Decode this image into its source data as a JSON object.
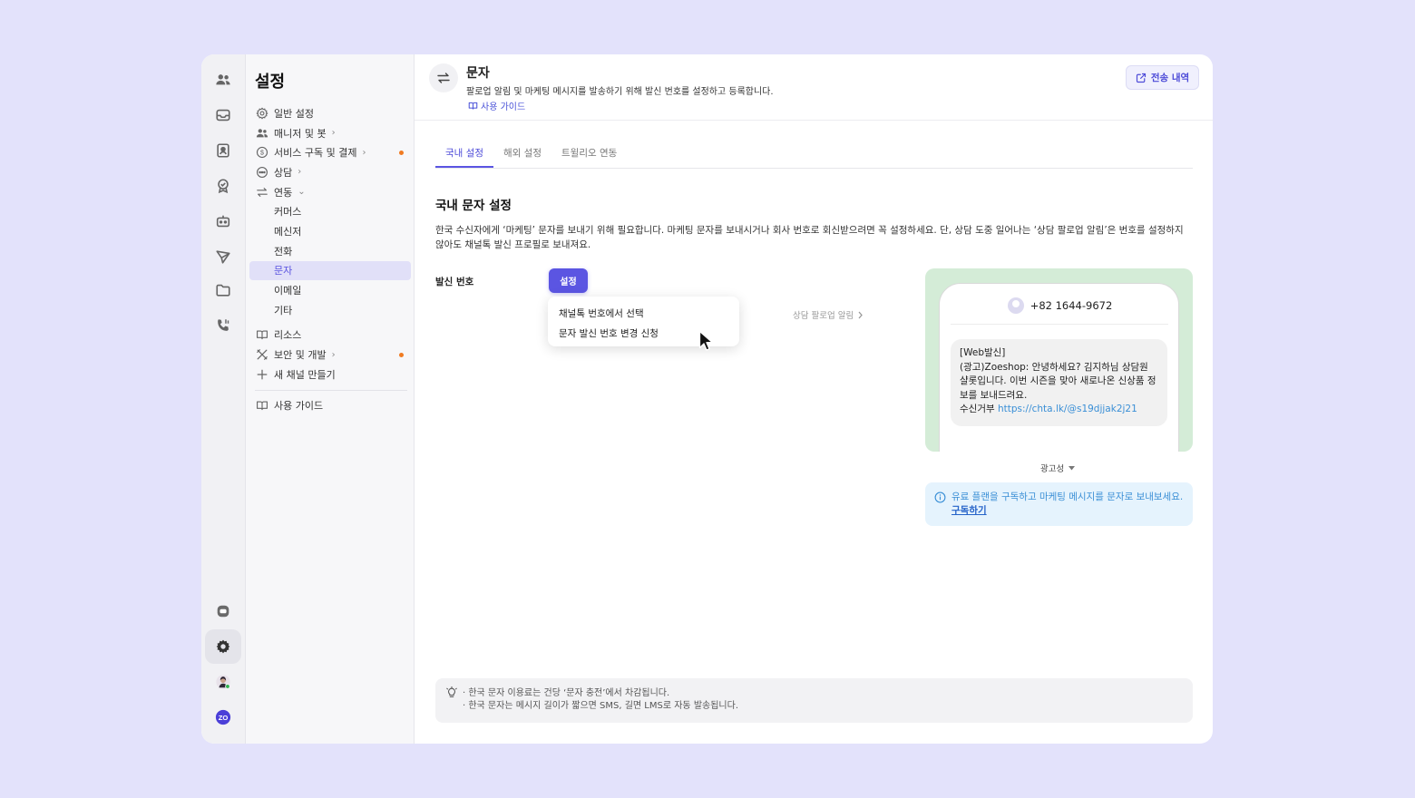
{
  "sidebar": {
    "title": "설정",
    "items": [
      {
        "label": "일반 설정"
      },
      {
        "label": "매니저 및 봇",
        "chev": "›"
      },
      {
        "label": "서비스 구독 및 결제",
        "chev": "›"
      },
      {
        "label": "상담",
        "chev": "›"
      },
      {
        "label": "연동",
        "chev": "⌄"
      },
      {
        "label": "커머스"
      },
      {
        "label": "메신저"
      },
      {
        "label": "전화"
      },
      {
        "label": "문자"
      },
      {
        "label": "이메일"
      },
      {
        "label": "기타"
      },
      {
        "label": "리소스"
      },
      {
        "label": "보안 및 개발",
        "chev": "›"
      },
      {
        "label": "새 채널 만들기"
      },
      {
        "label": "사용 가이드"
      }
    ]
  },
  "header": {
    "title": "문자",
    "description": "팔로업 알림 및 마케팅 메시지를 발송하기 위해 발신 번호를 설정하고 등록합니다.",
    "guide_link": "사용 가이드",
    "history_button": "전송 내역"
  },
  "tabs": [
    {
      "label": "국내 설정",
      "active": true
    },
    {
      "label": "해외 설정",
      "active": false
    },
    {
      "label": "트윌리오 연동",
      "active": false
    }
  ],
  "section": {
    "title": "국내 문자 설정",
    "description": "한국 수신자에게 ‘마케팅’ 문자를 보내기 위해 필요합니다. 마케팅 문자를 보내시거나 회사 번호로 회신받으려면 꼭 설정하세요. 단, 상담 도중 일어나는 ‘상담 팔로업 알림’은 번호를 설정하지 않아도 채널톡 발신 프로필로 보내져요."
  },
  "sender": {
    "label": "발신 번호",
    "set_button": "설정",
    "dropdown": [
      "채널톡 번호에서 선택",
      "문자 발신 번호 변경 신청"
    ],
    "followup_link": "상담 팔로업 알림"
  },
  "preview": {
    "phone_number": "+82 1644-9672",
    "message_lines": [
      "[Web발신]",
      "(광고)Zoeshop: 안녕하세요? 김지하님 상담원 샬롯입니다. 이번 시즌을 맞아 새로나온 신상품 정보를 보내드려요."
    ],
    "optout_label": "수신거부",
    "optout_link": "https://chta.lk/@s19djjak2j21",
    "ad_type": "광고성"
  },
  "info": {
    "text": "유료 플랜을 구독하고 마케팅 메시지를 문자로 보내보세요. ",
    "link": "구독하기"
  },
  "tips": [
    "· 한국 문자 이용료는 건당 ‘문자 충전’에서 차감됩니다.",
    "· 한국 문자는 메시지 길이가 짧으면 SMS, 길면 LMS로 자동 발송됩니다."
  ],
  "colors": {
    "accent": "#5b55e2",
    "background": "#e3e2fb",
    "notification_dot": "#f07b22",
    "preview_bg": "#d4ecd7",
    "info_bg": "#e5f3fd",
    "link": "#3a8fd6"
  },
  "icons": {
    "rail": [
      "users-icon",
      "inbox-icon",
      "contacts-icon",
      "badge-icon",
      "bot-icon",
      "send-icon",
      "folder-icon",
      "phone-call-icon",
      "chat-bubble-icon",
      "gear-icon",
      "user-avatar",
      "zo-logo"
    ]
  }
}
